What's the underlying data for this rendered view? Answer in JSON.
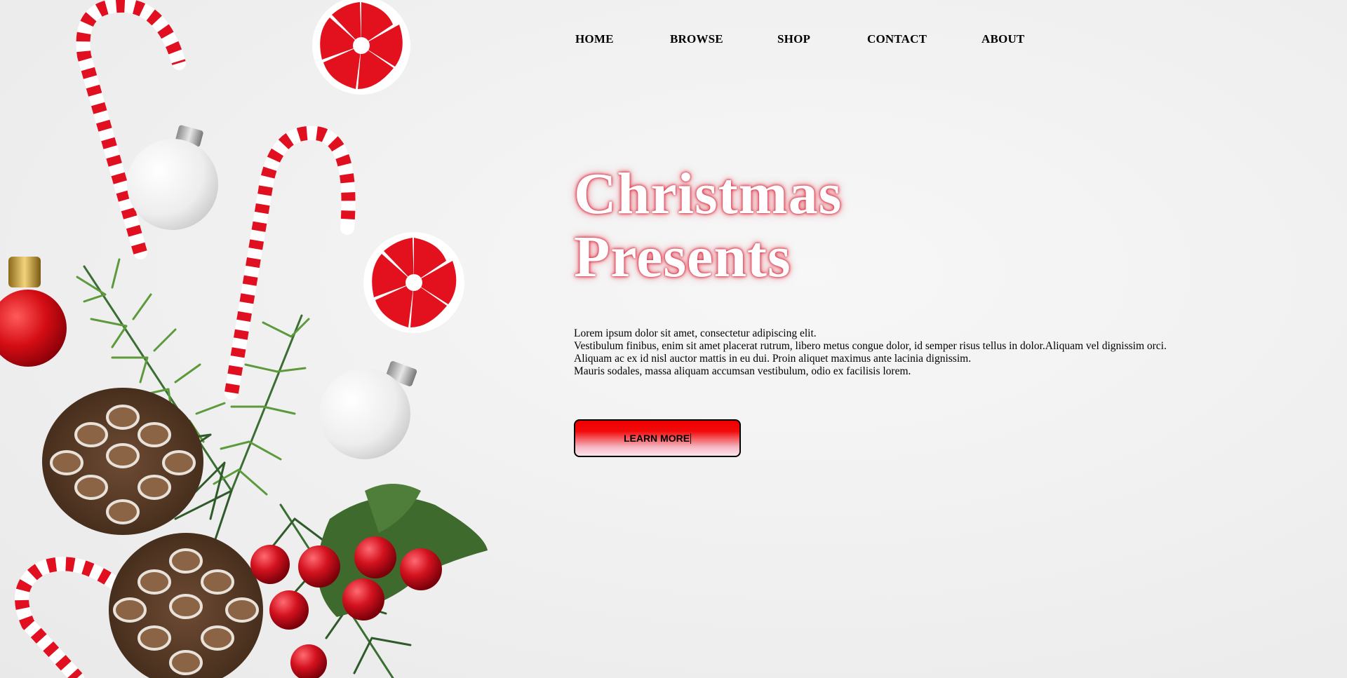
{
  "nav": {
    "items": [
      {
        "label": "HOME"
      },
      {
        "label": "BROWSE"
      },
      {
        "label": "SHOP"
      },
      {
        "label": "CONTACT"
      },
      {
        "label": "ABOUT"
      }
    ]
  },
  "hero": {
    "title_line1": "Christmas",
    "title_line2": "Presents",
    "body_lines": [
      "Lorem ipsum dolor sit amet, consectetur adipiscing elit.",
      "Vestibulum finibus, enim sit amet placerat rutrum, libero metus congue dolor, id semper risus tellus in dolor.Aliquam vel dignissim orci.",
      "Aliquam ac ex id nisl auctor mattis in eu dui. Proin aliquet maximus ante lacinia dignissim.",
      "Mauris sodales, massa aliquam accumsan vestibulum, odio ex facilisis lorem."
    ],
    "cta_label": "LEARN MORE"
  },
  "colors": {
    "accent_red": "#e10f1e",
    "title_glow": "#e0364a",
    "text": "#000000",
    "background": "#f2f2f2"
  },
  "decor": {
    "icons": [
      "candy-cane-icon",
      "peppermint-candy-icon",
      "ornament-ball-icon",
      "pine-cone-icon",
      "pine-branch-icon",
      "holly-berry-icon"
    ]
  }
}
